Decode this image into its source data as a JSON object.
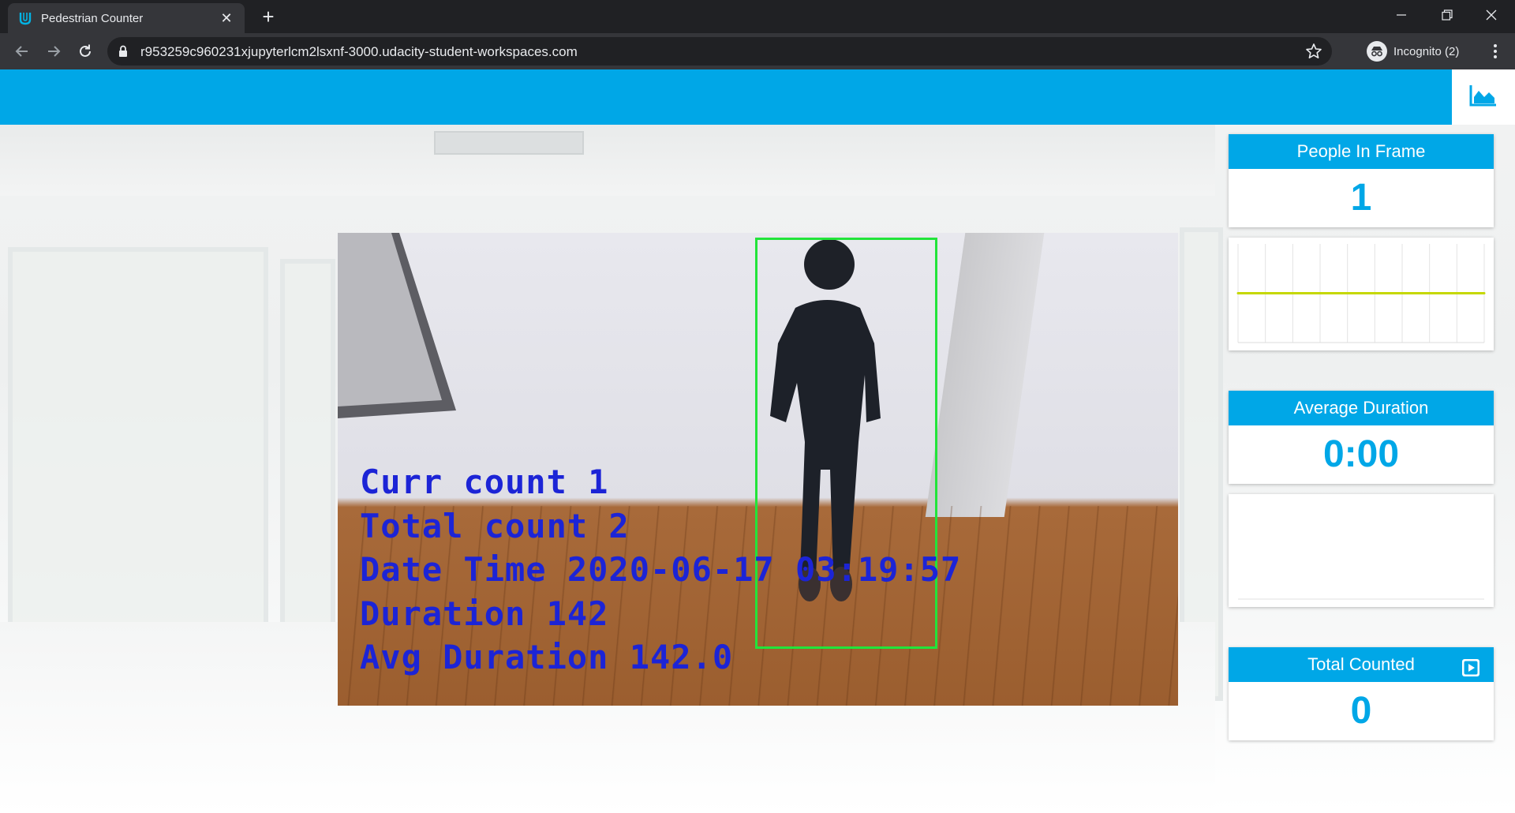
{
  "browser": {
    "tab_title": "Pedestrian Counter",
    "url": "r953259c960231xjupyterlcm2lsxnf-3000.udacity-student-workspaces.com",
    "incognito_label": "Incognito (2)"
  },
  "video_overlay": {
    "lines": [
      "Curr count 1",
      "Total count 2",
      "Date Time 2020-06-17 03:19:57",
      "Duration 142",
      "Avg Duration 142.0"
    ]
  },
  "stats": {
    "people_in_frame": {
      "label": "People In Frame",
      "value": "1"
    },
    "average_duration": {
      "label": "Average Duration",
      "value": "0:00"
    },
    "total_counted": {
      "label": "Total Counted",
      "value": "0"
    }
  },
  "colors": {
    "accent": "#00a7e7",
    "bbox": "#22e43a",
    "overlay_text": "#1c24d6",
    "chart_line": "#c5d800"
  },
  "icons": {
    "tab": "udacity-logo-icon",
    "header": "area-chart-icon",
    "total_counted": "play-icon"
  },
  "chart_data": {
    "type": "line",
    "series": [
      {
        "values": [
          1,
          1,
          1,
          1,
          1,
          1,
          1,
          1,
          1,
          1
        ]
      }
    ],
    "ylim": [
      0,
      2
    ],
    "grid": true
  }
}
